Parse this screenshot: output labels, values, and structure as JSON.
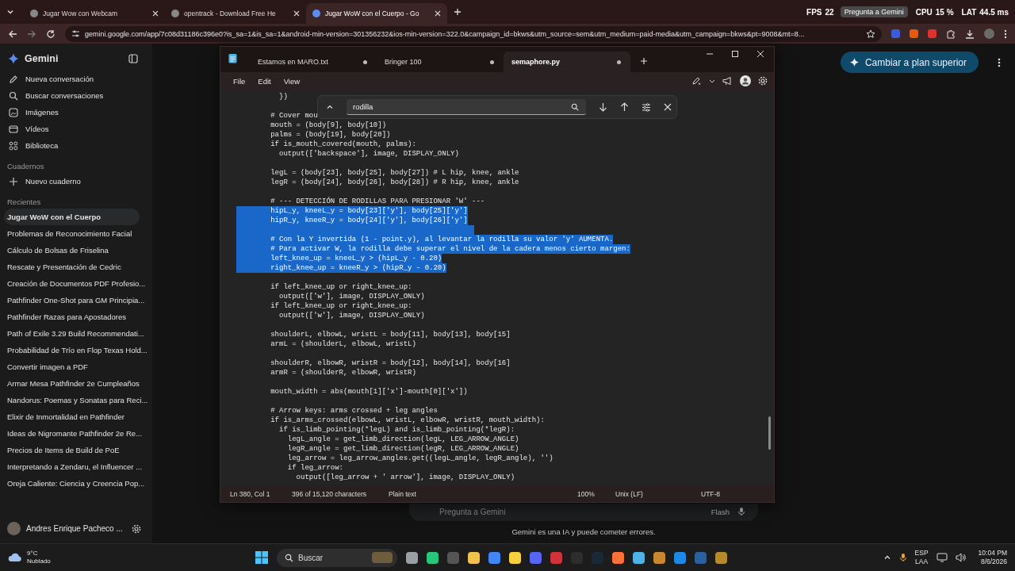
{
  "browser": {
    "tabs": [
      {
        "title": "Jugar Wow con Webcam",
        "selected": false
      },
      {
        "title": "opentrack - Download Free He",
        "selected": false
      },
      {
        "title": "Jugar WoW con el Cuerpo - Go",
        "selected": true
      }
    ],
    "address": "gemini.google.com/app/7c08d31186c396e0?is_sa=1&is_sa=1&android-min-version=301356232&ios-min-version=322.0&campaign_id=bkws&utm_source=sem&utm_medium=paid-media&utm_campaign=bkws&pt=9008&mt=8...",
    "overlay": {
      "stats": [
        {
          "label": "FPS",
          "value": "22"
        },
        {
          "label": "CPU",
          "value": "15 %"
        },
        {
          "label": "LAT",
          "value": "44.5 ms"
        }
      ],
      "tooltip": "Pregunta a Gemini"
    }
  },
  "sidebar": {
    "title": "Gemini",
    "menu": [
      {
        "label": "Nueva conversación",
        "kind": "new"
      },
      {
        "label": "Buscar conversaciones",
        "kind": "search"
      },
      {
        "label": "Imágenes",
        "kind": "images"
      },
      {
        "label": "Vídeos",
        "kind": "videos"
      },
      {
        "label": "Biblioteca",
        "kind": "library"
      }
    ],
    "notebooks_heading": "Cuadernos",
    "new_notebook": "Nuevo cuaderno",
    "recent_heading": "Recientes",
    "recent": [
      {
        "title": "Jugar WoW con el Cuerpo",
        "selected": true
      },
      {
        "title": "Problemas de Reconocimiento Facial",
        "selected": false
      },
      {
        "title": "Cálculo de Bolsas de Friselina",
        "selected": false
      },
      {
        "title": "Rescate y Presentación de Cedric",
        "selected": false
      },
      {
        "title": "Creación de Documentos PDF Profesio...",
        "selected": false
      },
      {
        "title": "Pathfinder One-Shot para GM Principia...",
        "selected": false
      },
      {
        "title": "Pathfinder Razas para Apostadores",
        "selected": false
      },
      {
        "title": "Path of Exile 3.29 Build Recommendati...",
        "selected": false
      },
      {
        "title": "Probabilidad de Trío en Flop Texas Hold...",
        "selected": false
      },
      {
        "title": "Convertir imagen a PDF",
        "selected": false
      },
      {
        "title": "Armar Mesa Pathfinder 2e Cumpleaños",
        "selected": false
      },
      {
        "title": "Nandorus: Poemas y Sonatas para Reci...",
        "selected": false
      },
      {
        "title": "Elixir de Inmortalidad en Pathfinder",
        "selected": false
      },
      {
        "title": "Ideas de Nigromante Pathfinder 2e Re...",
        "selected": false
      },
      {
        "title": "Precios de Items de Build de PoE",
        "selected": false
      },
      {
        "title": "Interpretando a Zendaru, el Influencer ...",
        "selected": false
      },
      {
        "title": "Oreja Caliente: Ciencia y Creencia Pop...",
        "selected": false
      }
    ],
    "user": "Andres Enrique Pacheco ..."
  },
  "main": {
    "upgrade": "Cambiar a plan superior",
    "prompt": {
      "placeholder": "Pregunta a Gemini",
      "model": "Flash"
    },
    "disclaimer": "Gemini es una IA y puede cometer errores."
  },
  "notepad": {
    "tabs": [
      {
        "title": "Estamos en MARO.txt",
        "modified": true,
        "selected": false
      },
      {
        "title": "Bringer 100",
        "modified": true,
        "selected": false
      },
      {
        "title": "semaphore.py",
        "modified": true,
        "selected": true
      }
    ],
    "menu": [
      "File",
      "Edit",
      "View"
    ],
    "find": {
      "value": "rodilla"
    },
    "lines": [
      {
        "text": "          })",
        "selected": false
      },
      {
        "selected": false
      },
      {
        "text": "        # Cover mou",
        "selected": false
      },
      {
        "text": "        mouth = (body[9], body[10])",
        "selected": false
      },
      {
        "text": "        palms = (body[19], body[20])",
        "selected": false
      },
      {
        "text": "        if is_mouth_covered(mouth, palms):",
        "selected": false
      },
      {
        "text": "          output(['backspace'], image, DISPLAY_ONLY)",
        "selected": false
      },
      {
        "selected": false
      },
      {
        "text": "        legL = (body[23], body[25], body[27]) # L hip, knee, ankle",
        "selected": false
      },
      {
        "text": "        legR = (body[24], body[26], body[28]) # R hip, knee, ankle",
        "selected": false
      },
      {
        "selected": false
      },
      {
        "text": "        # --- DETECCIÓN DE RODILLAS PARA PRESIONAR 'W' ---",
        "selected": false
      },
      {
        "text": "        hipL_y, kneeL_y = body[23]['y'], body[25]['y']",
        "selected": true
      },
      {
        "text": "        hipR_y, kneeR_y = body[24]['y'], body[26]['y']",
        "selected": true
      },
      {
        "selected": true
      },
      {
        "text": "        # Con la Y invertida (1 - point.y), al levantar la rodilla su valor 'y' AUMENTA.",
        "selected": true
      },
      {
        "text": "        # Para activar W, la rodilla debe superar el nivel de la cadera menos cierto margen:",
        "selected": true
      },
      {
        "text": "        left_knee_up = kneeL_y > (hipL_y - 0.20)",
        "selected": true
      },
      {
        "text": "        right_knee_up = kneeR_y > (hipR_y - 0.20)",
        "selected": true
      },
      {
        "selected": false
      },
      {
        "text": "        if left_knee_up or right_knee_up:",
        "selected": false
      },
      {
        "text": "          output(['w'], image, DISPLAY_ONLY)",
        "selected": false
      },
      {
        "text": "        if left_knee_up or right_knee_up:",
        "selected": false
      },
      {
        "text": "          output(['w'], image, DISPLAY_ONLY)",
        "selected": false
      },
      {
        "selected": false
      },
      {
        "text": "        shoulderL, elbowL, wristL = body[11], body[13], body[15]",
        "selected": false
      },
      {
        "text": "        armL = (shoulderL, elbowL, wristL)",
        "selected": false
      },
      {
        "selected": false
      },
      {
        "text": "        shoulderR, elbowR, wristR = body[12], body[14], body[16]",
        "selected": false
      },
      {
        "text": "        armR = (shoulderR, elbowR, wristR)",
        "selected": false
      },
      {
        "selected": false
      },
      {
        "text": "        mouth_width = abs(mouth[1]['x']-mouth[0]['x'])",
        "selected": false
      },
      {
        "selected": false
      },
      {
        "text": "        # Arrow keys: arms crossed + leg angles",
        "selected": false
      },
      {
        "text": "        if is_arms_crossed(elbowL, wristL, elbowR, wristR, mouth_width):",
        "selected": false
      },
      {
        "text": "          if is_limb_pointing(*legL) and is_limb_pointing(*legR):",
        "selected": false
      },
      {
        "text": "            legL_angle = get_limb_direction(legL, LEG_ARROW_ANGLE)",
        "selected": false
      },
      {
        "text": "            legR_angle = get_limb_direction(legR, LEG_ARROW_ANGLE)",
        "selected": false
      },
      {
        "text": "            leg_arrow = leg_arrow_angles.get((legL_angle, legR_angle), '')",
        "selected": false
      },
      {
        "text": "            if leg_arrow:",
        "selected": false
      },
      {
        "text": "              output([leg_arrow + ' arrow'], image, DISPLAY_ONLY)",
        "selected": false
      }
    ],
    "status": [
      "Ln 380, Col 1",
      "396 of 15,120 characters",
      "Plain text",
      "100%",
      "Unix (LF)",
      "UTF-8"
    ]
  },
  "taskbar": {
    "weather": {
      "temp": "9°C",
      "condition": "Nublado"
    },
    "search": {
      "placeholder": "Buscar"
    },
    "language": "ESP",
    "layout": "LAA",
    "time": "10:04 PM",
    "date": "8/6/2026"
  }
}
